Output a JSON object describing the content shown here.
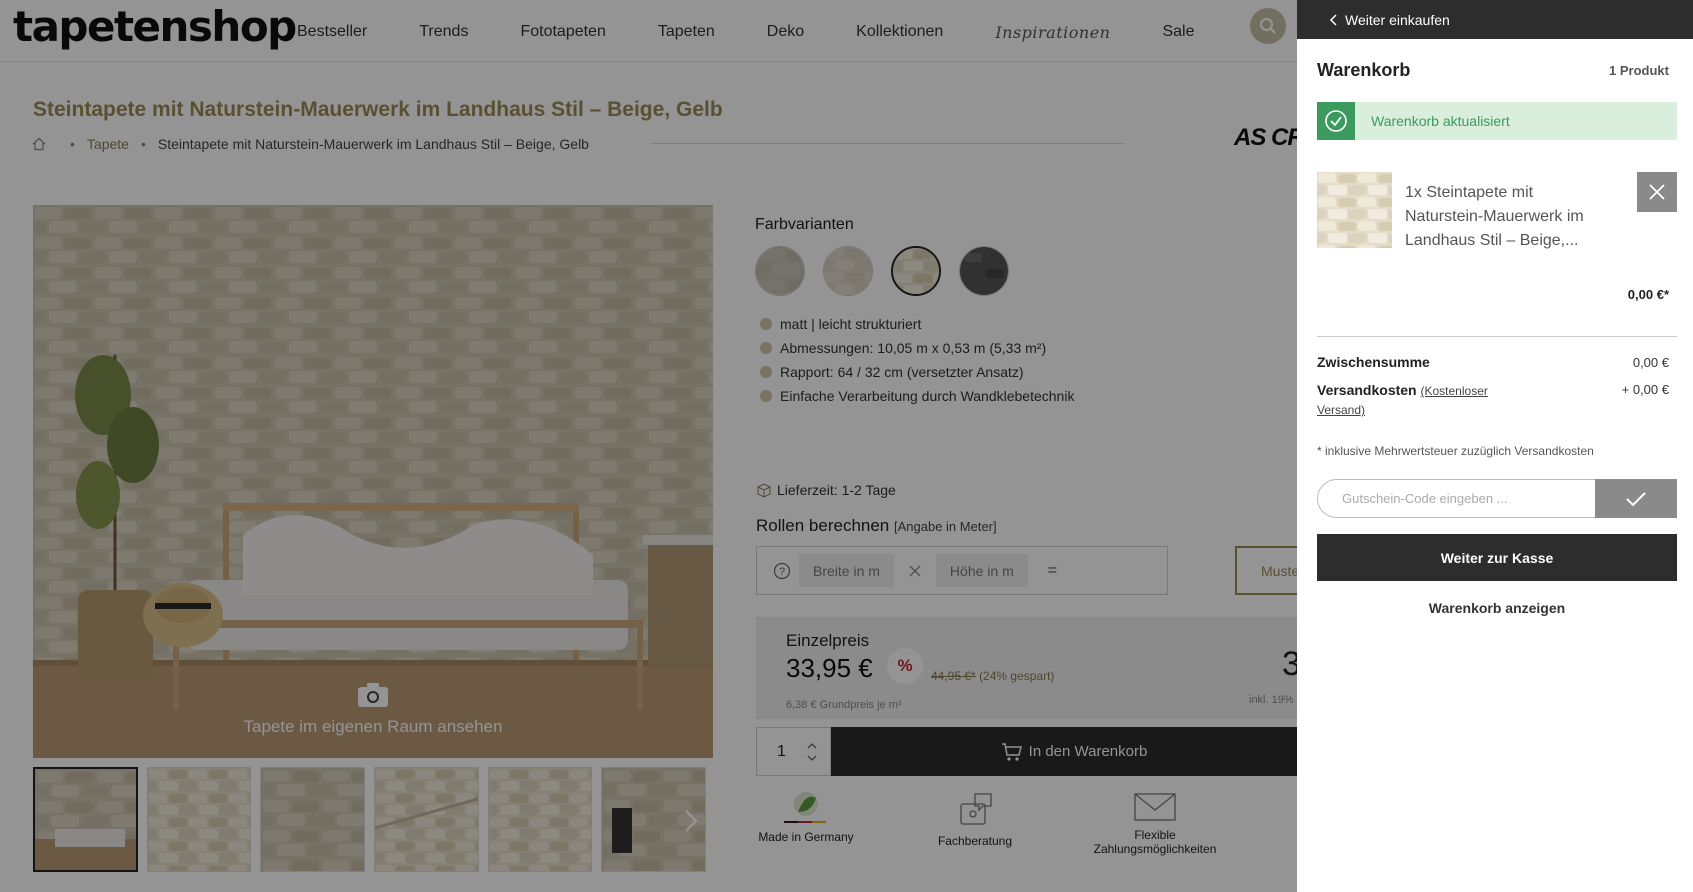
{
  "header": {
    "logo": "tapetenshop",
    "nav": [
      "Bestseller",
      "Trends",
      "Fototapeten",
      "Tapeten",
      "Deko",
      "Kollektionen",
      "Inspirationen",
      "Sale"
    ]
  },
  "product": {
    "title": "Steintapete mit Naturstein-Mauerwerk im Landhaus Stil – Beige, Gelb",
    "breadcrumb": [
      "Tapete",
      "Steintapete mit Naturstein-Mauerwerk im Landhaus Stil – Beige, Gelb"
    ],
    "brand": "AS CR",
    "camera_label": "Tapete im eigenen Raum ansehen",
    "color_variants_title": "Farbvarianten",
    "features": [
      "matt | leicht strukturiert",
      "Abmessungen: 10,05 m x 0,53 m (5,33 m²)",
      "Rapport: 64 / 32 cm (versetzter Ansatz)",
      "Einfache Verarbeitung durch Wandklebetechnik"
    ],
    "delivery": "Lieferzeit: 1-2 Tage",
    "rollen_title": "Rollen berechnen",
    "rollen_hint": "[Angabe in Meter]",
    "width_placeholder": "Breite in m",
    "height_placeholder": "Höhe in m",
    "equals": "=",
    "sample_button": "Muste",
    "price_label": "Einzelpreis",
    "price": "33,95 €",
    "discount_symbol": "%",
    "old_price": "44,95 €*",
    "saving": "(24% gespart)",
    "base_price": "6,38 € Grundpreis je m²",
    "price_right": "3",
    "price_right_note": "inkl. 19% M",
    "quantity": "1",
    "add_to_cart": "In den Warenkorb",
    "trust": [
      "Made in Germany",
      "Fachberatung",
      "Flexible Zahlungsmöglichkeiten"
    ]
  },
  "cart": {
    "back": "Weiter einkaufen",
    "title": "Warenkorb",
    "count": "1 Produkt",
    "success": "Warenkorb aktualisiert",
    "item_title": "1x Steintapete mit Naturstein-Mauerwerk im Landhaus Stil – Beige,...",
    "item_price": "0,00 €*",
    "subtotal_label": "Zwischensumme",
    "subtotal_value": "0,00 €",
    "shipping_label": "Versandkosten",
    "shipping_link": "(Kostenloser Versand)",
    "shipping_value": "+ 0,00 €",
    "tax_note": "* inklusive Mehrwertsteuer zuzüglich Versandkosten",
    "coupon_placeholder": "Gutschein-Code eingeben ...",
    "checkout": "Weiter zur Kasse",
    "view_cart": "Warenkorb anzeigen"
  },
  "colors": {
    "accent": "#9a8a55",
    "success": "#3c9a5f",
    "dark": "#2d2d2d"
  }
}
